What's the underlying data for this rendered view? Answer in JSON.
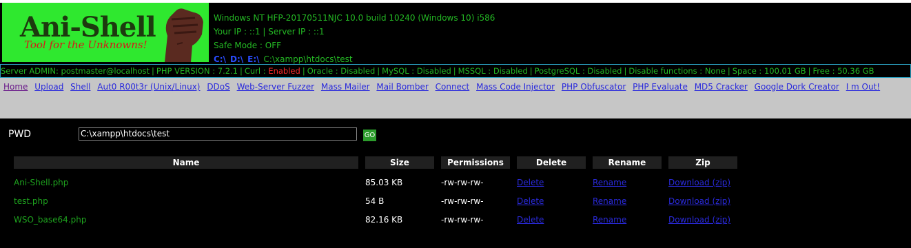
{
  "logo": {
    "title": "Ani-Shell",
    "subtitle": "Tool for the Unknowns!"
  },
  "sysinfo": {
    "os": "Windows NT HFP-20170511NJC 10.0 build 10240 (Windows 10) i586",
    "ip": "Your IP : ::1 | Server IP : ::1",
    "safe_mode": "Safe Mode : OFF",
    "drives": [
      "C:\\",
      "D:\\",
      "E:\\"
    ],
    "cwd": "C:\\xampp\\htdocs\\test"
  },
  "status": {
    "admin": "Server ADMIN: postmaster@localhost",
    "php": "PHP VERSION : 7.2.1",
    "curl_label": "Curl :",
    "curl_value": "Enabled",
    "oracle": "Oracle : Disabled",
    "mysql": "MySQL : Disabled",
    "mssql": "MSSQL : Disabled",
    "postgres": "PostgreSQL : Disabled",
    "disable_functions": "Disable functions : None",
    "space": "Space : 100.01 GB",
    "free": "Free : 50.36 GB",
    "enabled_color": "#ff2b2b"
  },
  "nav": {
    "items": [
      "Home",
      "Upload",
      "Shell",
      "Aut0 R00t3r (Unix/Linux)",
      "DDoS",
      "Web-Server Fuzzer",
      "Mass Mailer",
      "Mail Bomber",
      "Connect",
      "Mass Code Injector",
      "PHP Obfuscator",
      "PHP Evaluate",
      "MD5 Cracker",
      "Google Dork Creator",
      "I m Out!"
    ]
  },
  "pwd": {
    "label": "PWD",
    "value": "C:\\xampp\\htdocs\\test",
    "go_label": "GO"
  },
  "table": {
    "headers": [
      "Name",
      "Size",
      "Permissions",
      "Delete",
      "Rename",
      "Zip"
    ],
    "rows": [
      {
        "name": "Ani-Shell.php",
        "size": "85.03 KB",
        "perm": "-rw-rw-rw-",
        "delete": "Delete",
        "rename": "Rename",
        "zip": "Download (zip)"
      },
      {
        "name": "test.php",
        "size": "54 B",
        "perm": "-rw-rw-rw-",
        "delete": "Delete",
        "rename": "Rename",
        "zip": "Download (zip)"
      },
      {
        "name": "WSO_base64.php",
        "size": "82.16 KB",
        "perm": "-rw-rw-rw-",
        "delete": "Delete",
        "rename": "Rename",
        "zip": "Download (zip)"
      }
    ]
  },
  "colors": {
    "accent_green": "#24b924",
    "link_blue": "#2a2adc",
    "drive_blue": "#2a4cff"
  }
}
